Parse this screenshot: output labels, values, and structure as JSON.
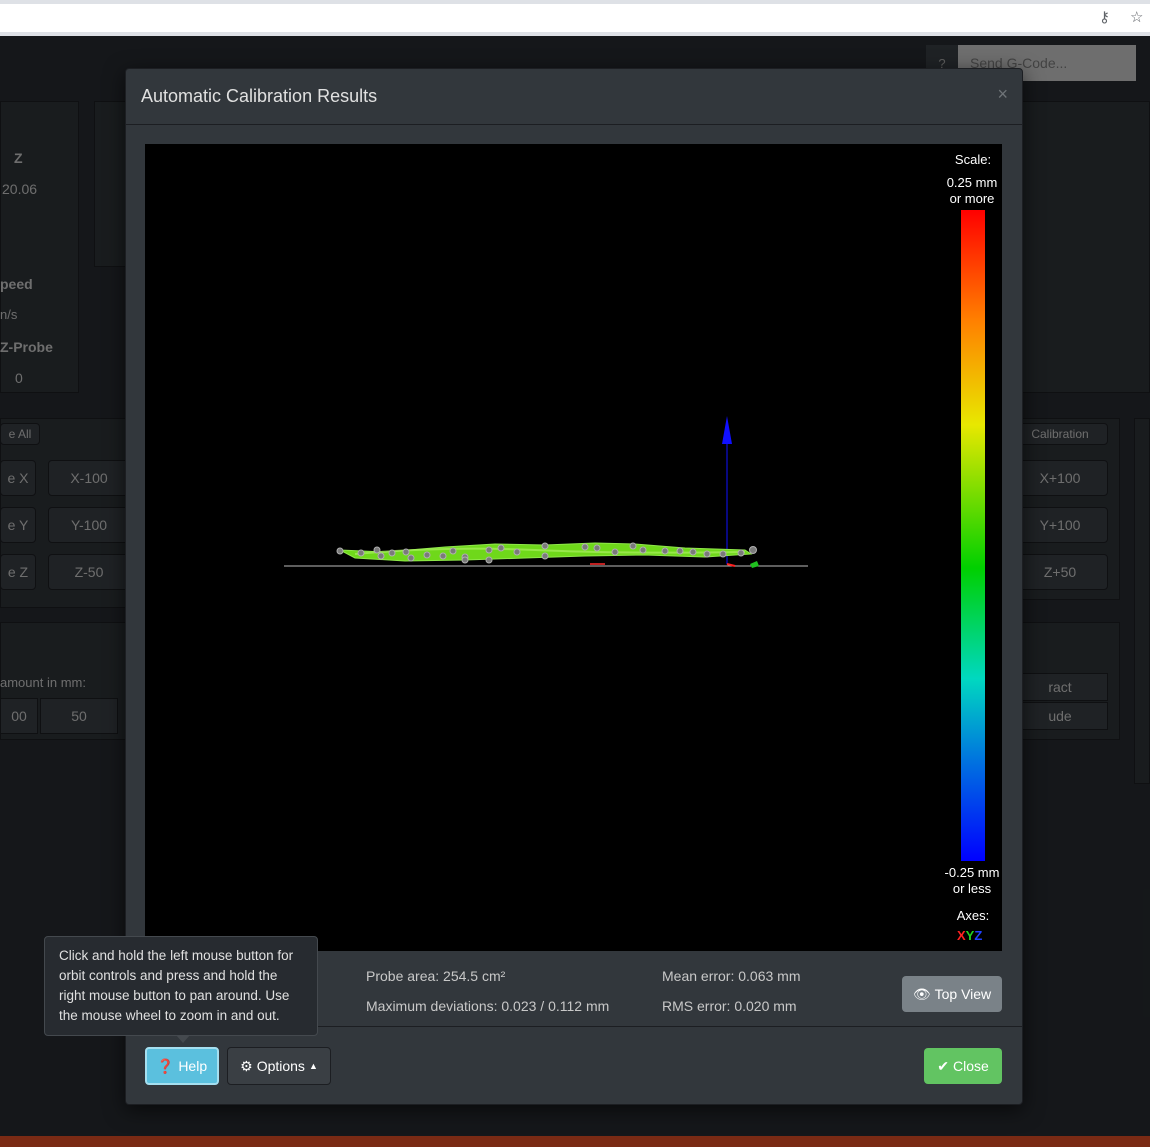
{
  "browser": {
    "key_icon": "key-icon",
    "star_icon": "star-icon"
  },
  "background": {
    "help_label": "?",
    "gcode_placeholder": "Send G-Code...",
    "col_z": "Z",
    "z_value": "20.06",
    "speed_label": "peed",
    "speed_unit": "n/s",
    "zprobe_label": "Z-Probe",
    "zprobe_value": "0",
    "home_all": "e All",
    "home_x": "e X",
    "home_y": "e Y",
    "home_z": "e Z",
    "x_minus": "X-100",
    "y_minus": "Y-100",
    "z_minus": "Z-50",
    "calibration_btn": "Calibration",
    "x_plus": "X+100",
    "y_plus": "Y+100",
    "z_plus": "Z+50",
    "amount_label": "amount in mm:",
    "amount_00": "00",
    "amount_50": "50",
    "retract": "ract",
    "extrude": "ude"
  },
  "modal": {
    "title": "Automatic Calibration Results",
    "close_x": "×",
    "scale_title": "Scale:",
    "scale_top_1": "0.25 mm",
    "scale_top_2": "or more",
    "scale_bottom_1": "-0.25 mm",
    "scale_bottom_2": "or less",
    "axes_label": "Axes:",
    "axis_x": "X",
    "axis_y": "Y",
    "axis_z": "Z",
    "axis_colors": {
      "x": "#ff2020",
      "y": "#20d020",
      "z": "#2040ff"
    },
    "probe_area": "Probe area: 254.5 cm²",
    "max_dev": "Maximum deviations: 0.023 / 0.112 mm",
    "mean_error": "Mean error: 0.063 mm",
    "rms_error": "RMS error: 0.020 mm",
    "top_view": "Top View",
    "help": "Help",
    "options": "Options",
    "close": "Close",
    "tooltip": "Click and hold the left mouse button for orbit controls and press and hold the right mouse button to pan around. Use the mouse wheel to zoom in and out."
  }
}
